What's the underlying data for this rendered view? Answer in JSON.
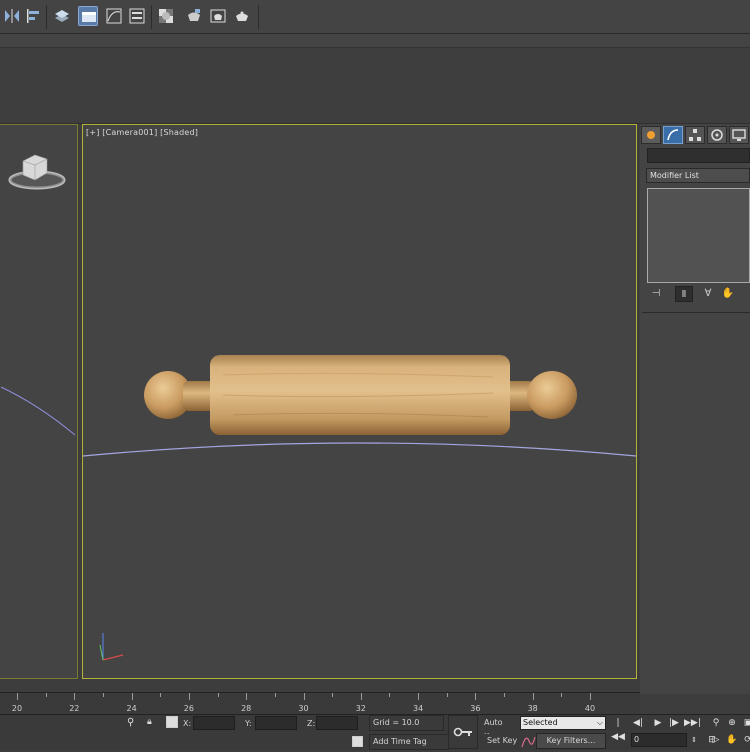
{
  "viewport": {
    "label": "[+] [Camera001] [Shaded]"
  },
  "command_panel": {
    "modifier_list_label": "Modifier List"
  },
  "timeline": {
    "ticks": [
      "20",
      "22",
      "24",
      "26",
      "28",
      "30",
      "32",
      "34",
      "36",
      "38",
      "40"
    ]
  },
  "status": {
    "x_label": "X:",
    "y_label": "Y:",
    "z_label": "Z:",
    "grid_label": "Grid = 10.0",
    "add_time_tag": "Add Time Tag",
    "auto_key": "Auto Key",
    "set_key": "Set Key",
    "selected_option": "Selected",
    "key_filters": "Key Filters...",
    "frame_value": "0"
  },
  "colors": {
    "viewport_bg": "#444444",
    "active_border": "#b2b23a",
    "wood": "#c8a06a"
  }
}
